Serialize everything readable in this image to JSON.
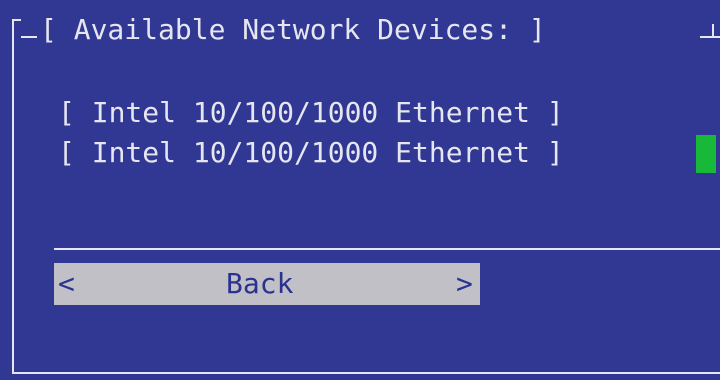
{
  "dialog": {
    "title": "[ Available Network Devices: ]"
  },
  "devices": [
    {
      "label": "[ Intel 10/100/1000 Ethernet ]"
    },
    {
      "label": "[ Intel 10/100/1000 Ethernet ]"
    }
  ],
  "buttons": {
    "back": {
      "left_marker": "<",
      "label": "Back",
      "right_marker": ">"
    }
  },
  "colors": {
    "background": "#303894",
    "text": "#e6e6f0",
    "button_bg": "#c0c0c6",
    "button_text": "#2a3290",
    "cursor": "#18b838"
  }
}
